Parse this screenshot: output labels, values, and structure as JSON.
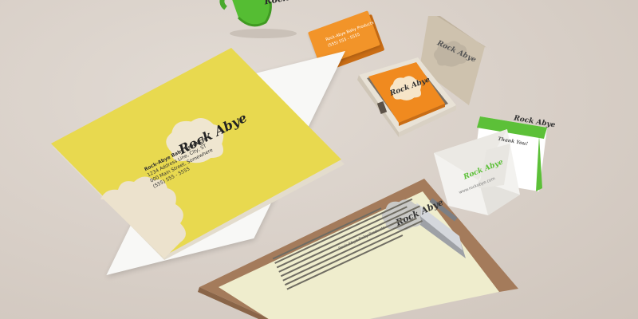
{
  "brand": {
    "name": "Rock Abye",
    "company": "Rock-Abye Baby Products",
    "address_line1": "1234 Address Line, City, ST",
    "address_line2": "000 Main Street, Somewhere",
    "phone": "(555) 555 - 5555",
    "website": "www.rockabye.com"
  },
  "note_card": {
    "greeting": "Thank You!"
  },
  "letterhead": {
    "sender": "Rock-Abye Baby Products"
  },
  "colors": {
    "background": "#d9d1ca",
    "yellow": "#e8d94f",
    "orange": "#f08a1f",
    "green": "#5cc038",
    "kraft": "#cfc2ae",
    "cream": "#efeccd",
    "clipboard": "#a57c5d",
    "cloud": "#eadfca"
  },
  "icons": [
    "cloud-logo-icon"
  ]
}
